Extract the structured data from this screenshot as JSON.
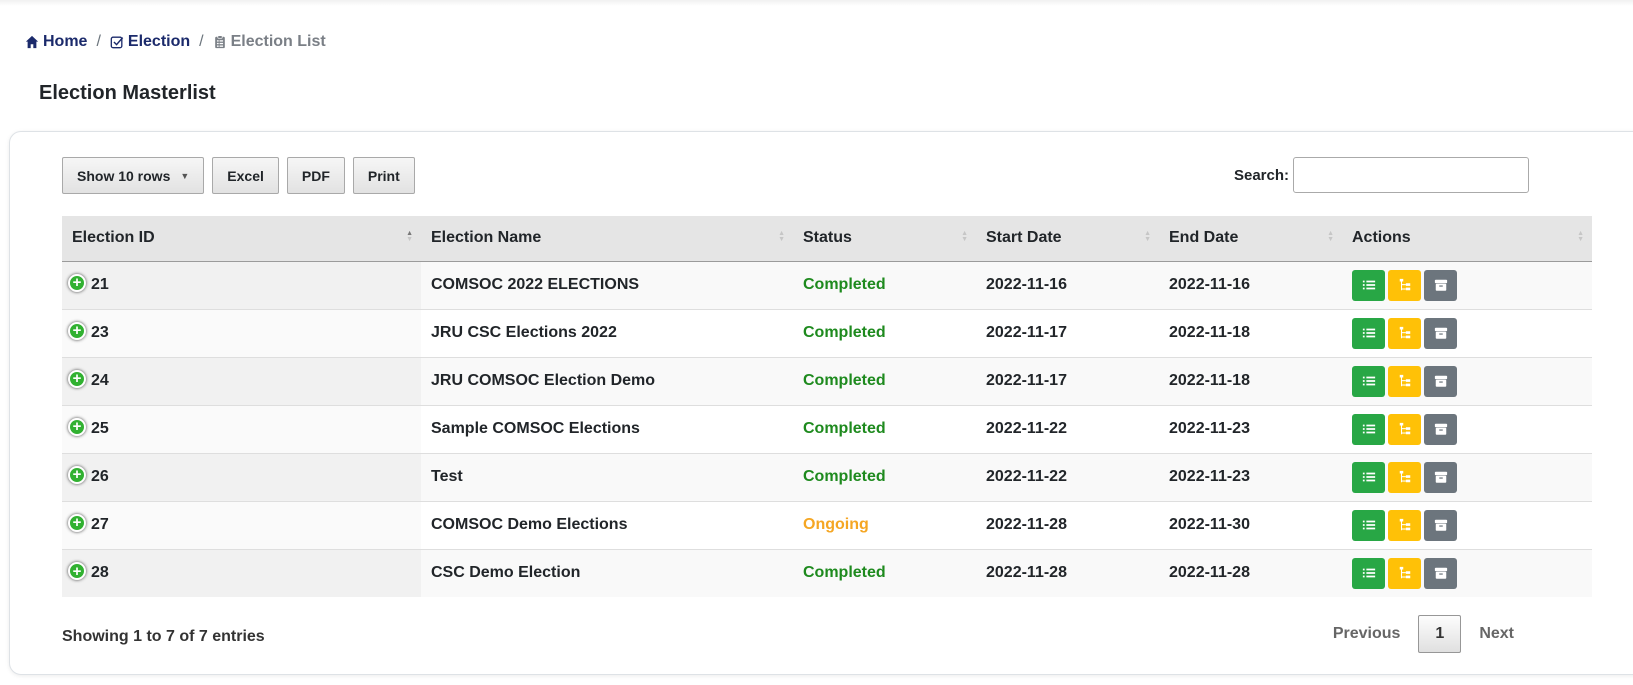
{
  "breadcrumb": {
    "home": "Home",
    "election": "Election",
    "current": "Election List"
  },
  "page_title": "Election Masterlist",
  "toolbar": {
    "show_rows": "Show 10 rows",
    "excel": "Excel",
    "pdf": "PDF",
    "print": "Print"
  },
  "search": {
    "label": "Search:",
    "placeholder": ""
  },
  "table": {
    "headers": [
      "Election ID",
      "Election Name",
      "Status",
      "Start Date",
      "End Date",
      "Actions"
    ],
    "rows": [
      {
        "id": "21",
        "name": "COMSOC 2022 ELECTIONS",
        "status": "Completed",
        "start": "2022-11-16",
        "end": "2022-11-16"
      },
      {
        "id": "23",
        "name": "JRU CSC Elections 2022",
        "status": "Completed",
        "start": "2022-11-17",
        "end": "2022-11-18"
      },
      {
        "id": "24",
        "name": "JRU COMSOC Election Demo",
        "status": "Completed",
        "start": "2022-11-17",
        "end": "2022-11-18"
      },
      {
        "id": "25",
        "name": "Sample COMSOC Elections",
        "status": "Completed",
        "start": "2022-11-22",
        "end": "2022-11-23"
      },
      {
        "id": "26",
        "name": "Test",
        "status": "Completed",
        "start": "2022-11-22",
        "end": "2022-11-23"
      },
      {
        "id": "27",
        "name": "COMSOC Demo Elections",
        "status": "Ongoing",
        "start": "2022-11-28",
        "end": "2022-11-30"
      },
      {
        "id": "28",
        "name": "CSC Demo Election",
        "status": "Completed",
        "start": "2022-11-28",
        "end": "2022-11-28"
      }
    ],
    "action_icons": [
      "list-icon",
      "sitemap-icon",
      "archive-icon"
    ]
  },
  "footer": {
    "info": "Showing 1 to 7 of 7 entries",
    "previous": "Previous",
    "page": "1",
    "next": "Next"
  },
  "colors": {
    "completed": "#1e8a1e",
    "ongoing": "#f5a623",
    "action_green": "#28a745",
    "action_yellow": "#ffc107",
    "action_gray": "#6c757d",
    "breadcrumb_link": "#1b2a6b"
  }
}
